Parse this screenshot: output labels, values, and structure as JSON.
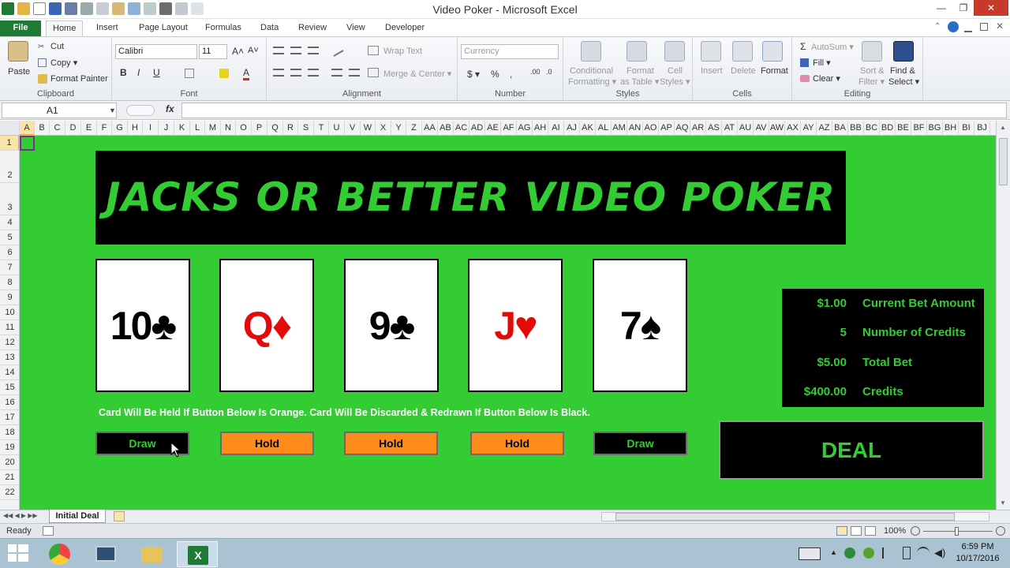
{
  "window": {
    "title": "Video Poker  -  Microsoft Excel",
    "minimize": "—",
    "restore": "❐",
    "close": "✕"
  },
  "ribbon_tabs": [
    "File",
    "Home",
    "Insert",
    "Page Layout",
    "Formulas",
    "Data",
    "Review",
    "View",
    "Developer"
  ],
  "ribbon": {
    "clipboard": {
      "paste": "Paste",
      "cut": "Cut",
      "copy": "Copy ▾",
      "format_painter": "Format Painter",
      "label": "Clipboard"
    },
    "font": {
      "name": "Calibri",
      "size": "11",
      "label": "Font"
    },
    "alignment": {
      "wrap": "Wrap Text",
      "merge": "Merge & Center ▾",
      "label": "Alignment"
    },
    "number": {
      "format": "Currency",
      "label": "Number"
    },
    "styles": {
      "conditional": "Conditional",
      "conditional2": "Formatting ▾",
      "format_table": "Format",
      "format_table2": "as Table ▾",
      "cell_styles": "Cell",
      "cell_styles2": "Styles ▾",
      "label": "Styles"
    },
    "cells": {
      "insert": "Insert",
      "delete": "Delete",
      "format": "Format",
      "label": "Cells"
    },
    "editing": {
      "autosum": "AutoSum ▾",
      "fill": "Fill ▾",
      "clear": "Clear ▾",
      "sort": "Sort &",
      "sort2": "Filter ▾",
      "find": "Find &",
      "find2": "Select ▾",
      "label": "Editing"
    }
  },
  "formula_bar": {
    "name_box": "A1",
    "fx": "fx",
    "value": ""
  },
  "columns": [
    "A",
    "B",
    "C",
    "D",
    "E",
    "F",
    "G",
    "H",
    "I",
    "J",
    "K",
    "L",
    "M",
    "N",
    "O",
    "P",
    "Q",
    "R",
    "S",
    "T",
    "U",
    "V",
    "W",
    "X",
    "Y",
    "Z",
    "AA",
    "AB",
    "AC",
    "AD",
    "AE",
    "AF",
    "AG",
    "AH",
    "AI",
    "AJ",
    "AK",
    "AL",
    "AM",
    "AN",
    "AO",
    "AP",
    "AQ",
    "AR",
    "AS",
    "AT",
    "AU",
    "AV",
    "AW",
    "AX",
    "AY",
    "AZ",
    "BA",
    "BB",
    "BC",
    "BD",
    "BE",
    "BF",
    "BG",
    "BH",
    "BI",
    "BJ"
  ],
  "rows": [
    "1",
    "2",
    "3",
    "4",
    "5",
    "6",
    "7",
    "8",
    "9",
    "10",
    "11",
    "12",
    "13",
    "14",
    "15",
    "16",
    "17",
    "18",
    "19",
    "20",
    "21",
    "22"
  ],
  "game": {
    "banner": "JACKS OR BETTER VIDEO POKER",
    "cards": [
      {
        "rank": "10",
        "suit": "♣",
        "color": "black"
      },
      {
        "rank": "Q",
        "suit": "♦",
        "color": "red"
      },
      {
        "rank": "9",
        "suit": "♣",
        "color": "black"
      },
      {
        "rank": "J",
        "suit": "♥",
        "color": "red"
      },
      {
        "rank": "7",
        "suit": "♠",
        "color": "black"
      }
    ],
    "card_labels": [
      "10♣",
      "Q♦",
      "9♣",
      "J♥",
      "7♠"
    ],
    "instruction": "Card Will Be Held If Button Below Is Orange. Card Will Be Discarded & Redrawn If Button Below Is Black.",
    "buttons": [
      "Draw",
      "Hold",
      "Hold",
      "Hold",
      "Draw"
    ],
    "info": [
      {
        "value": "$1.00",
        "label": "Current Bet Amount"
      },
      {
        "value": "5",
        "label": "Number of Credits"
      },
      {
        "value": "$5.00",
        "label": "Total Bet"
      },
      {
        "value": "$400.00",
        "label": "Credits"
      }
    ],
    "deal": "DEAL"
  },
  "sheet_tab": "Initial Deal",
  "status": {
    "ready": "Ready",
    "zoom": "100%"
  },
  "taskbar": {
    "time": "6:59 PM",
    "date": "10/17/2016"
  },
  "colors": {
    "sheet_bg": "#33cc33",
    "hold": "#ff8c1a",
    "red_suit": "#e30a0a"
  }
}
